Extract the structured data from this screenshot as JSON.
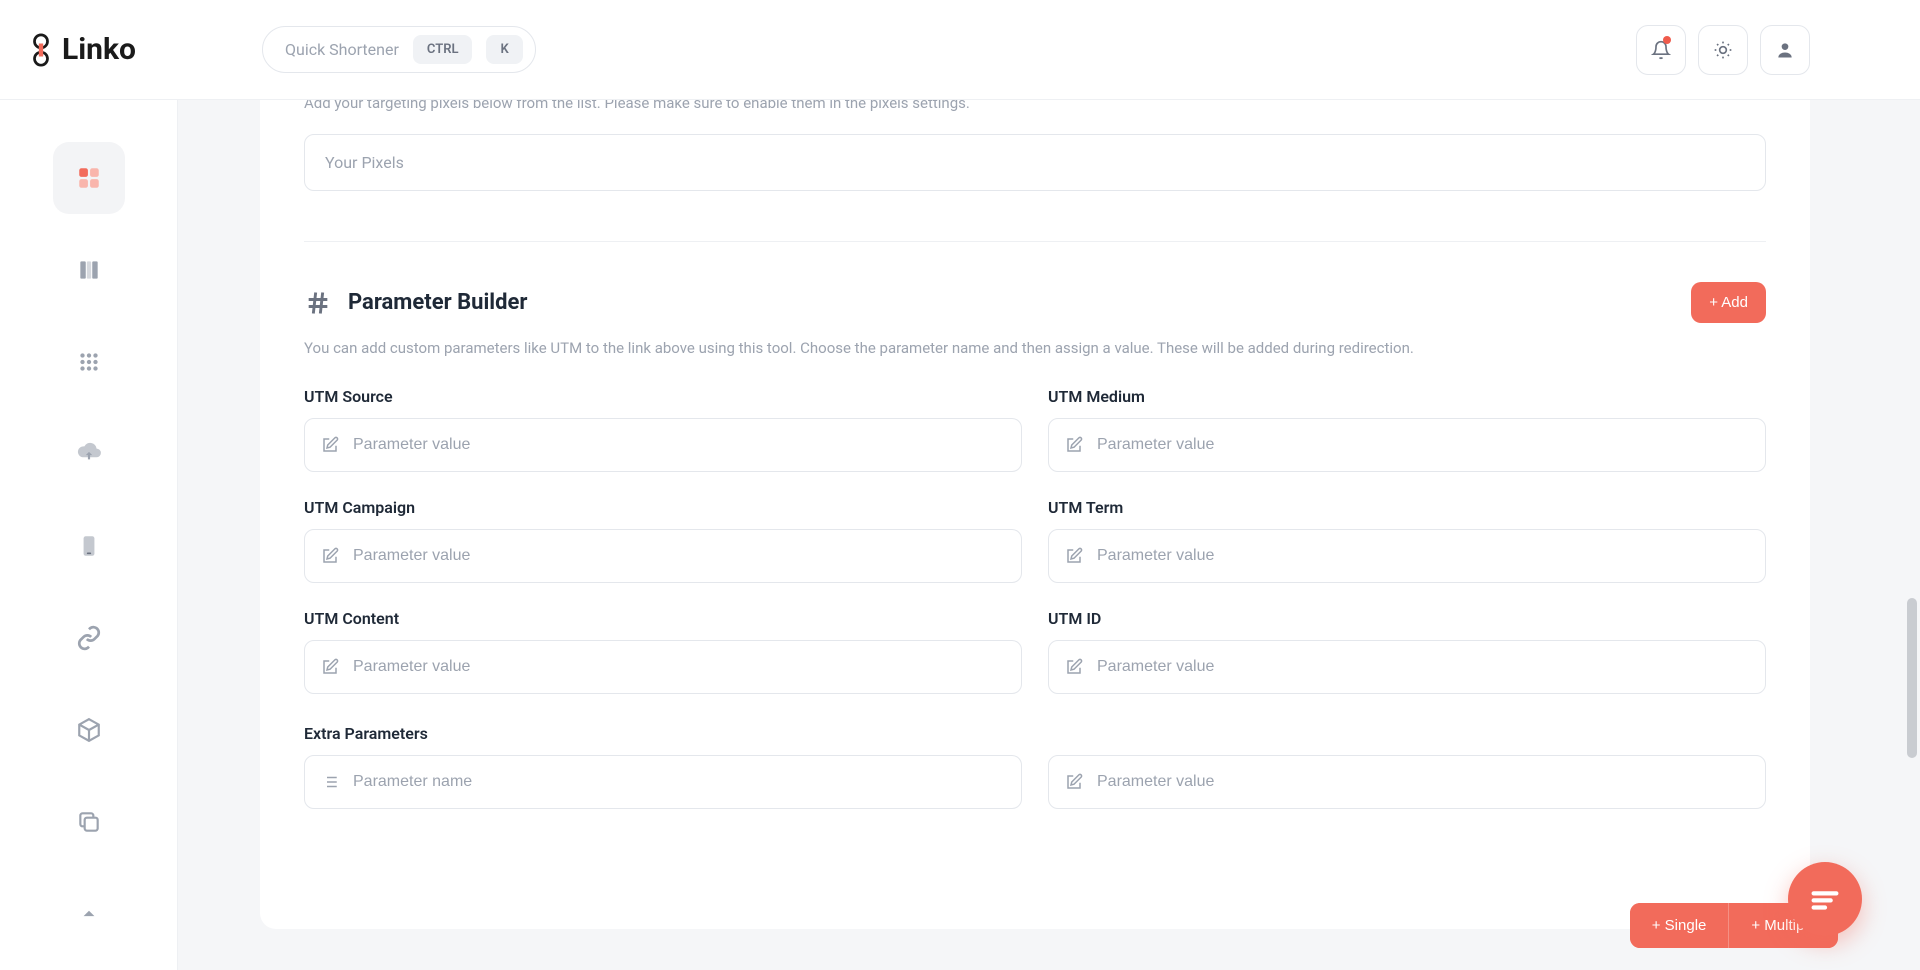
{
  "brand": {
    "name": "Linko"
  },
  "topbar": {
    "search_placeholder": "Quick Shortener",
    "kbd_ctrl": "CTRL",
    "kbd_k": "K"
  },
  "pixels": {
    "description": "Add your targeting pixels below from the list. Please make sure to enable them in the pixels settings.",
    "input_placeholder": "Your Pixels"
  },
  "parameter_builder": {
    "title": "Parameter Builder",
    "add_label": "+ Add",
    "description": "You can add custom parameters like UTM to the link above using this tool. Choose the parameter name and then assign a value. These will be added during redirection.",
    "fields": {
      "utm_source": {
        "label": "UTM Source",
        "placeholder": "Parameter value"
      },
      "utm_medium": {
        "label": "UTM Medium",
        "placeholder": "Parameter value"
      },
      "utm_campaign": {
        "label": "UTM Campaign",
        "placeholder": "Parameter value"
      },
      "utm_term": {
        "label": "UTM Term",
        "placeholder": "Parameter value"
      },
      "utm_content": {
        "label": "UTM Content",
        "placeholder": "Parameter value"
      },
      "utm_id": {
        "label": "UTM ID",
        "placeholder": "Parameter value"
      }
    },
    "extra": {
      "label": "Extra Parameters",
      "name_placeholder": "Parameter name",
      "value_placeholder": "Parameter value"
    }
  },
  "actions": {
    "single": "+ Single",
    "multiple": "+ Multiple"
  },
  "colors": {
    "accent": "#f26b5b"
  }
}
